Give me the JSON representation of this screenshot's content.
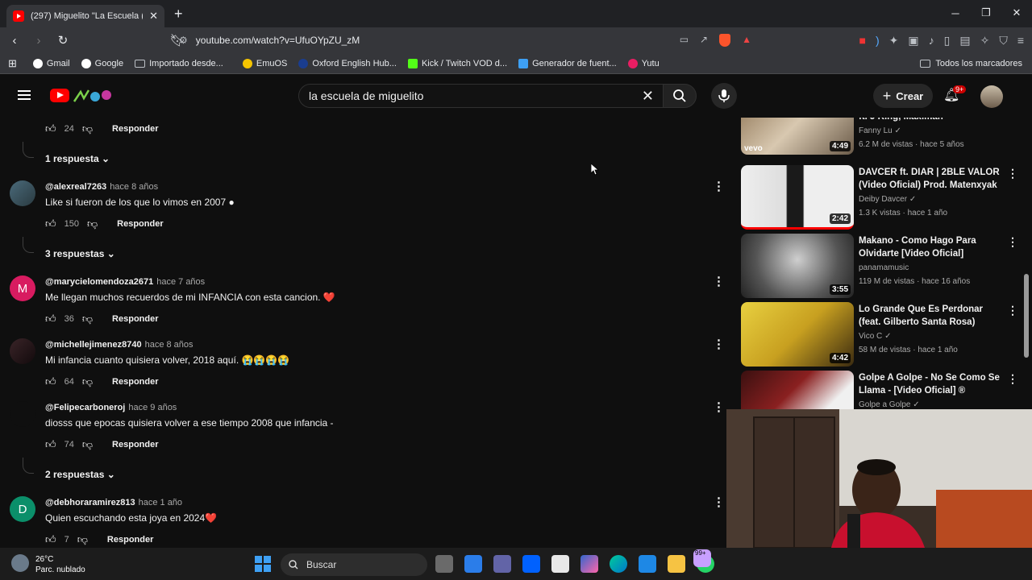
{
  "browser": {
    "tab_title": "(297) Miguelito \"La Escuela (Mi I",
    "url": "youtube.com/watch?v=UfuOYpZU_zM",
    "bookmarks": [
      "Gmail",
      "Google",
      "Importado desde...",
      "EmuOS",
      "Oxford English Hub...",
      "Kick / Twitch VOD d...",
      "Generador de fuent...",
      "Yutu"
    ],
    "all_bookmarks": "Todos los marcadores"
  },
  "youtube": {
    "search_query": "la escuela de miguelito",
    "create_label": "Crear",
    "notif_count": "9+"
  },
  "comments": [
    {
      "likes": "24",
      "reply_label": "Responder",
      "replies_label": "1 respuesta"
    },
    {
      "author": "@alexreal7263",
      "time": "hace 8 años",
      "text": "Like si fueron de los que lo vimos en 2007 ●",
      "likes": "150",
      "reply_label": "Responder",
      "replies_label": "3 respuestas"
    },
    {
      "author": "@marycielomendoza2671",
      "time": "hace 7 años",
      "text": "Me llegan muchos recuerdos de mi INFANCIA con esta cancion. ❤️",
      "likes": "36",
      "reply_label": "Responder",
      "avatar_letter": "M"
    },
    {
      "author": "@michellejimenez8740",
      "time": "hace 8 años",
      "text": "Mi infancia cuanto quisiera volver,  2018 aquí. 😭😭😭😭",
      "likes": "64",
      "reply_label": "Responder"
    },
    {
      "author": "@Felipecarboneroj",
      "time": "hace 9 años",
      "text": "diosss que epocas quisiera volver a ese tiempo 2008 que infancia -",
      "likes": "74",
      "reply_label": "Responder",
      "replies_label": "2 respuestas"
    },
    {
      "author": "@debhoraramirez813",
      "time": "hace 1 año",
      "text": "Quien escuchando esta joya en 2024❤️",
      "likes": "7",
      "reply_label": "Responder",
      "avatar_letter": "D"
    }
  ],
  "sidebar": [
    {
      "title": "ft. J King, Maximan",
      "channel": "Fanny Lu",
      "meta": "6.2 M de vistas · hace 5 años",
      "duration": "4:49",
      "badge": "vevo"
    },
    {
      "title": "DAVCER ft. DIAR | 2BLE VALOR (Video Oficial) Prod. Matenxyak",
      "channel": "Deiby Davcer",
      "meta": "1.3 K vistas · hace 1 año",
      "duration": "2:42"
    },
    {
      "title": "Makano - Como Hago Para Olvidarte [Video Oficial]",
      "channel": "panamamusic",
      "meta": "119 M de vistas · hace 16 años",
      "duration": "3:55"
    },
    {
      "title": "Lo Grande Que Es Perdonar (feat. Gilberto Santa Rosa)",
      "channel": "Vico C",
      "meta": "58 M de vistas · hace 1 año",
      "duration": "4:42"
    },
    {
      "title": "Golpe A Golpe - No Se Como Se Llama - [Video Oficial] ®",
      "channel": "Golpe a Golpe",
      "meta": "",
      "duration": ""
    }
  ],
  "taskbar": {
    "temp": "26°C",
    "weather": "Parc. nublado",
    "search_label": "Buscar",
    "notif_badge": "99+"
  }
}
